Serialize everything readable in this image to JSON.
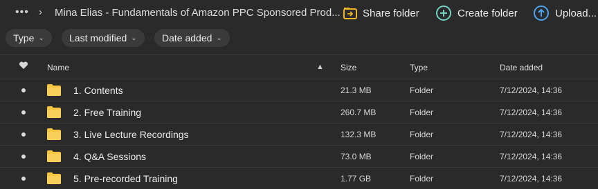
{
  "topbar": {
    "more_icon": "more-dots-icon",
    "breadcrumb_separator": "›",
    "breadcrumb_title": "Mina Elias - Fundamentals of Amazon PPC Sponsored Prod...",
    "share_label": "Share folder",
    "create_label": "Create folder",
    "upload_label": "Upload..."
  },
  "filters": {
    "type_label": "Type",
    "modified_label": "Last modified",
    "added_label": "Date added"
  },
  "table": {
    "headers": {
      "name": "Name",
      "size": "Size",
      "type": "Type",
      "date": "Date added"
    },
    "rows": [
      {
        "name": "1. Contents",
        "size": "21.3 MB",
        "type": "Folder",
        "date": "7/12/2024, 14:36"
      },
      {
        "name": "2. Free Training",
        "size": "260.7 MB",
        "type": "Folder",
        "date": "7/12/2024, 14:36"
      },
      {
        "name": "3. Live Lecture Recordings",
        "size": "132.3 MB",
        "type": "Folder",
        "date": "7/12/2024, 14:36"
      },
      {
        "name": "4. Q&A Sessions",
        "size": "73.0 MB",
        "type": "Folder",
        "date": "7/12/2024, 14:36"
      },
      {
        "name": "5. Pre-recorded Training",
        "size": "1.77 GB",
        "type": "Folder",
        "date": "7/12/2024, 14:36"
      }
    ]
  },
  "colors": {
    "background": "#2a2a2a",
    "share_icon": "#f0b429",
    "create_icon": "#6fd3c0",
    "upload_icon": "#4aa3f0",
    "folder": "#f5c542"
  }
}
